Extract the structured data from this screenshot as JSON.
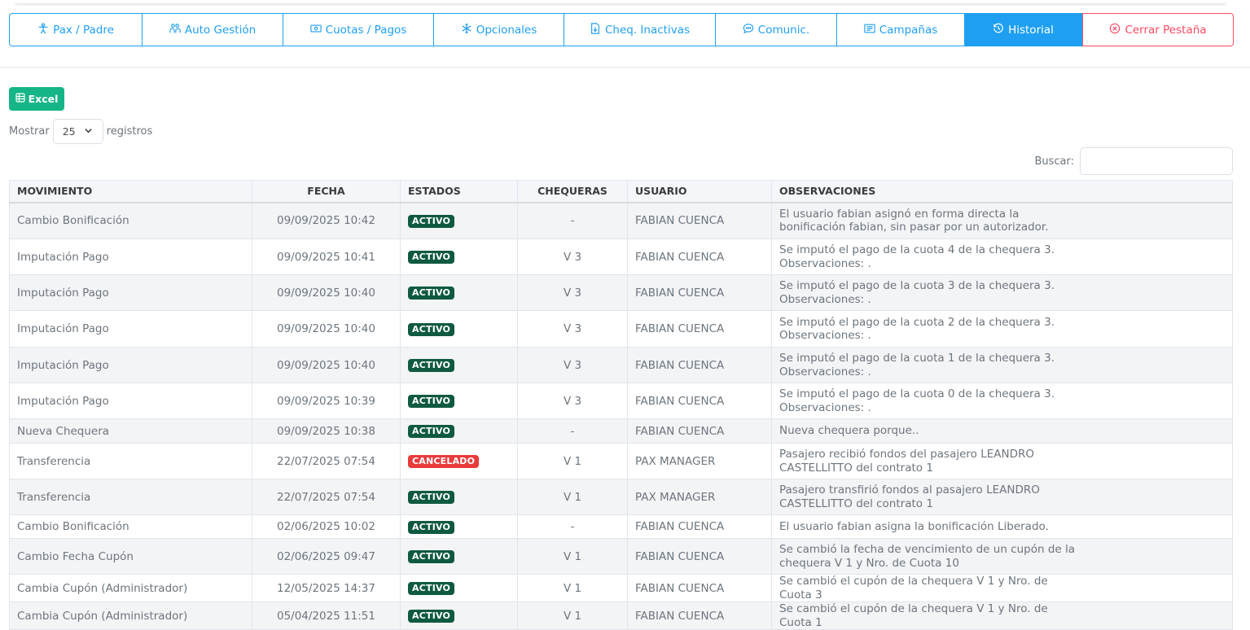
{
  "tabs": [
    {
      "label": "Pax / Padre",
      "icon": "person-icon",
      "active": false
    },
    {
      "label": "Auto Gestión",
      "icon": "users-icon",
      "active": false
    },
    {
      "label": "Cuotas / Pagos",
      "icon": "cash-icon",
      "active": false
    },
    {
      "label": "Opcionales",
      "icon": "snowflake-icon",
      "active": false
    },
    {
      "label": "Cheq. Inactivas",
      "icon": "file-icon",
      "active": false
    },
    {
      "label": "Comunic.",
      "icon": "chat-icon",
      "active": false
    },
    {
      "label": "Campañas",
      "icon": "newspaper-icon",
      "active": false
    },
    {
      "label": "Historial",
      "icon": "history-icon",
      "active": true
    }
  ],
  "close_tab": {
    "label": "Cerrar Pestaña",
    "icon": "close-circle-icon"
  },
  "excel_button": "Excel",
  "length_menu": {
    "prefix": "Mostrar",
    "value": "25",
    "suffix": "registros"
  },
  "search": {
    "label": "Buscar:",
    "value": ""
  },
  "table": {
    "headers": [
      "MOVIMIENTO",
      "FECHA",
      "ESTADOS",
      "CHEQUERAS",
      "USUARIO",
      "OBSERVACIONES"
    ],
    "rows": [
      {
        "movimiento": "Cambio Bonificación",
        "fecha": "09/09/2025 10:42",
        "estado": "ACTIVO",
        "chequera": "-",
        "usuario": "FABIAN CUENCA",
        "obs": "El usuario fabian asignó en forma directa la bonificación fabian, sin pasar por un autorizador."
      },
      {
        "movimiento": "Imputación Pago",
        "fecha": "09/09/2025 10:41",
        "estado": "ACTIVO",
        "chequera": "V 3",
        "usuario": "FABIAN CUENCA",
        "obs": "Se imputó el pago de la cuota 4 de la chequera 3. Observaciones: ."
      },
      {
        "movimiento": "Imputación Pago",
        "fecha": "09/09/2025 10:40",
        "estado": "ACTIVO",
        "chequera": "V 3",
        "usuario": "FABIAN CUENCA",
        "obs": "Se imputó el pago de la cuota 3 de la chequera 3. Observaciones: ."
      },
      {
        "movimiento": "Imputación Pago",
        "fecha": "09/09/2025 10:40",
        "estado": "ACTIVO",
        "chequera": "V 3",
        "usuario": "FABIAN CUENCA",
        "obs": "Se imputó el pago de la cuota 2 de la chequera 3. Observaciones: ."
      },
      {
        "movimiento": "Imputación Pago",
        "fecha": "09/09/2025 10:40",
        "estado": "ACTIVO",
        "chequera": "V 3",
        "usuario": "FABIAN CUENCA",
        "obs": "Se imputó el pago de la cuota 1 de la chequera 3. Observaciones: ."
      },
      {
        "movimiento": "Imputación Pago",
        "fecha": "09/09/2025 10:39",
        "estado": "ACTIVO",
        "chequera": "V 3",
        "usuario": "FABIAN CUENCA",
        "obs": "Se imputó el pago de la cuota 0 de la chequera 3. Observaciones: ."
      },
      {
        "movimiento": "Nueva Chequera",
        "fecha": "09/09/2025 10:38",
        "estado": "ACTIVO",
        "chequera": "-",
        "usuario": "FABIAN CUENCA",
        "obs": "Nueva chequera porque.."
      },
      {
        "movimiento": "Transferencia",
        "fecha": "22/07/2025 07:54",
        "estado": "CANCELADO",
        "chequera": "V 1",
        "usuario": "PAX MANAGER",
        "obs": "Pasajero recibió fondos del pasajero LEANDRO CASTELLITTO del contrato 1"
      },
      {
        "movimiento": "Transferencia",
        "fecha": "22/07/2025 07:54",
        "estado": "ACTIVO",
        "chequera": "V 1",
        "usuario": "PAX MANAGER",
        "obs": "Pasajero transfirió fondos al pasajero LEANDRO CASTELLITTO del contrato 1"
      },
      {
        "movimiento": "Cambio Bonificación",
        "fecha": "02/06/2025 10:02",
        "estado": "ACTIVO",
        "chequera": "-",
        "usuario": "FABIAN CUENCA",
        "obs": "El usuario fabian asigna la bonificación Liberado."
      },
      {
        "movimiento": "Cambio Fecha Cupón",
        "fecha": "02/06/2025 09:47",
        "estado": "ACTIVO",
        "chequera": "V 1",
        "usuario": "FABIAN CUENCA",
        "obs": "Se cambió la fecha de vencimiento de un cupón de la chequera V 1 y Nro. de Cuota 10"
      },
      {
        "movimiento": "Cambia Cupón (Administrador)",
        "fecha": "12/05/2025 14:37",
        "estado": "ACTIVO",
        "chequera": "V 1",
        "usuario": "FABIAN CUENCA",
        "obs": "Se cambió el cupón de la chequera V 1 y Nro. de Cuota 3"
      },
      {
        "movimiento": "Cambia Cupón (Administrador)",
        "fecha": "05/04/2025 11:51",
        "estado": "ACTIVO",
        "chequera": "V 1",
        "usuario": "FABIAN CUENCA",
        "obs": "Se cambió el cupón de la chequera V 1 y Nro. de Cuota 1"
      }
    ]
  },
  "colors": {
    "primary": "#1e9ff2",
    "danger": "#ff4961",
    "success": "#16b587",
    "badge_activo": "#0e5a40",
    "badge_cancelado": "#ea3b3b"
  }
}
